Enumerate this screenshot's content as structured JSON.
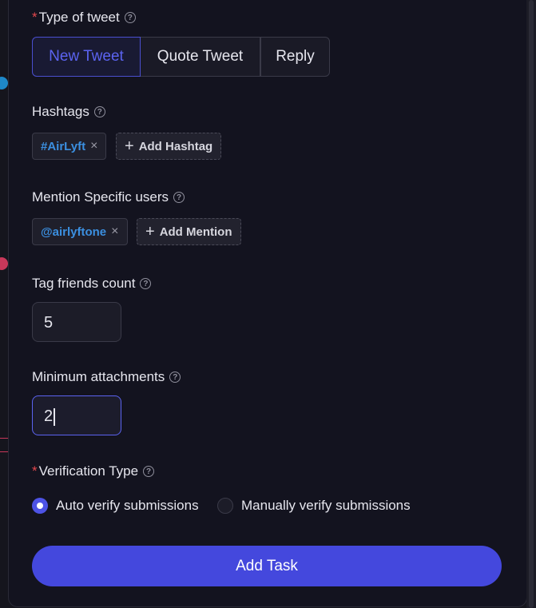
{
  "form": {
    "tweet_type": {
      "required_mark": "*",
      "label": "Type of tweet",
      "options": [
        "New Tweet",
        "Quote Tweet",
        "Reply"
      ],
      "selected": "New Tweet"
    },
    "hashtags": {
      "label": "Hashtags",
      "items": [
        "#AirLyft"
      ],
      "add_label": "Add Hashtag"
    },
    "mentions": {
      "label": "Mention Specific users",
      "items": [
        "@airlyftone"
      ],
      "add_label": "Add Mention"
    },
    "tag_friends": {
      "label": "Tag friends count",
      "value": "5"
    },
    "min_attachments": {
      "label": "Minimum attachments",
      "value": "2"
    },
    "verification": {
      "required_mark": "*",
      "label": "Verification Type",
      "options": [
        "Auto verify submissions",
        "Manually verify submissions"
      ],
      "selected": "Auto verify submissions"
    },
    "submit_label": "Add Task"
  },
  "icons": {
    "help": "question-circle-icon",
    "remove": "close-icon",
    "add": "plus-icon"
  },
  "colors": {
    "accent": "#4448dd",
    "required": "#e5484d",
    "tag_text": "#3b8fe0",
    "background": "#13131f"
  },
  "glyphs": {
    "help": "?",
    "remove": "×",
    "add": "+"
  }
}
